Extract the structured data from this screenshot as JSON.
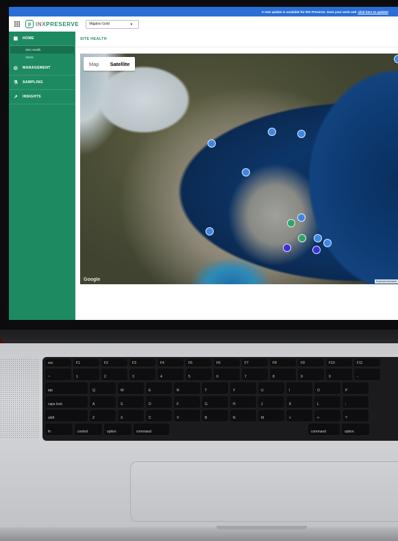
{
  "banner": {
    "message": "A new update is available for INX Preserve. Save your work and",
    "link": "click here to update!"
  },
  "app": {
    "logo_mark": "p",
    "logo_text_a": "INX",
    "logo_text_b": "PRESERVE",
    "site_select_value": "Migaloo Gold",
    "page_title": "SITE HEALTH"
  },
  "sidebar": {
    "items": [
      {
        "label": "HOME",
        "icon": "dashboard-icon"
      },
      {
        "label": "MANAGEMENT",
        "icon": "target-icon"
      },
      {
        "label": "SAMPLING",
        "icon": "flask-icon"
      },
      {
        "label": "INSIGHTS",
        "icon": "trend-icon"
      }
    ],
    "home_subitems": [
      "Site Health",
      "Alerts"
    ]
  },
  "map": {
    "toggle_map": "Map",
    "toggle_satellite": "Satellite",
    "selected": "Satellite",
    "attribution": "Google",
    "keyboard_shortcuts": "Keyboard shortcuts"
  },
  "keyboard": {
    "row1": [
      "esc",
      "F1",
      "F2",
      "F3",
      "F4",
      "F5",
      "F6",
      "F7",
      "F8",
      "F9",
      "F10",
      "F11"
    ],
    "row2": [
      "~",
      "1",
      "2",
      "3",
      "4",
      "5",
      "6",
      "7",
      "8",
      "9",
      "0",
      "-"
    ],
    "row3": [
      "tab",
      "Q",
      "W",
      "E",
      "R",
      "T",
      "Y",
      "U",
      "I",
      "O",
      "P"
    ],
    "row4": [
      "caps lock",
      "A",
      "S",
      "D",
      "F",
      "G",
      "H",
      "J",
      "K",
      "L",
      ";"
    ],
    "row5": [
      "shift",
      "Z",
      "X",
      "C",
      "V",
      "B",
      "N",
      "M",
      "<",
      ">",
      "?"
    ],
    "row6": [
      "fn",
      "control",
      "option",
      "command",
      "command",
      "option"
    ]
  },
  "colors": {
    "brand": "#1e8a62",
    "banner": "#2a6fd6"
  }
}
